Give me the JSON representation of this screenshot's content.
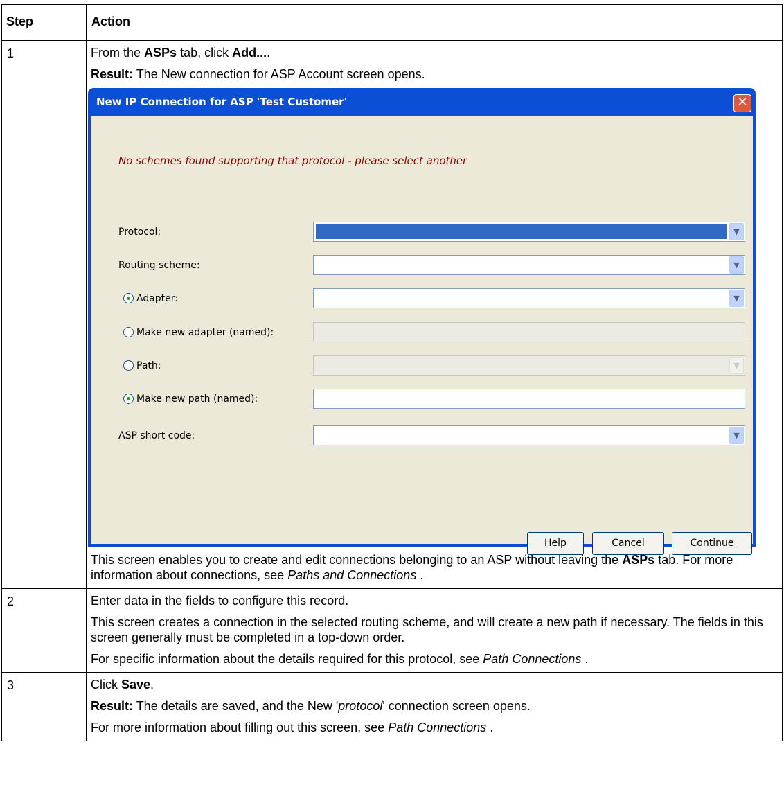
{
  "table": {
    "header_step": "Step",
    "header_action": "Action"
  },
  "step1": {
    "num": "1",
    "l1_a": "From the ",
    "l1_b": "ASPs",
    "l1_c": " tab, click ",
    "l1_d": "Add...",
    "l1_e": ".",
    "l2_a": "Result:",
    "l2_b": " The New connection for ASP Account screen opens.",
    "l3_a": "This screen enables you to create and edit connections belonging to an ASP without leaving the ",
    "l3_b": "ASPs",
    "l3_c": " tab. For more information about connections, see ",
    "l3_d": "Paths and Connections",
    "l3_e": " ."
  },
  "dialog": {
    "title": "New IP Connection for ASP 'Test Customer'",
    "close_glyph": "✕",
    "error": "No schemes found supporting that protocol - please select another",
    "protocol_label": "Protocol:",
    "routing_label": "Routing scheme:",
    "adapter_label": "Adapter:",
    "new_adapter_label": "Make new adapter (named):",
    "path_label": "Path:",
    "new_path_label": "Make new path (named):",
    "short_code_label": "ASP short code:",
    "help_label": "Help",
    "cancel_label": "Cancel",
    "continue_label": "Continue",
    "arrow_glyph": "▼"
  },
  "step2": {
    "num": "2",
    "l1": "Enter data in the fields to configure this record.",
    "l2": "This screen creates a connection in the selected routing scheme, and will create a new path if necessary. The fields in this screen generally must be completed in a top-down order.",
    "l3_a": "For specific information about the details required for this protocol, see ",
    "l3_b": "Path Connections",
    "l3_c": " ."
  },
  "step3": {
    "num": "3",
    "l1_a": "Click ",
    "l1_b": "Save",
    "l1_c": ".",
    "l2_a": "Result:",
    "l2_b": " The details are saved, and the New '",
    "l2_c": "protocol",
    "l2_d": "' connection screen opens.",
    "l3_a": "For more information about filling out this screen, see ",
    "l3_b": "Path Connections",
    "l3_c": " ."
  }
}
